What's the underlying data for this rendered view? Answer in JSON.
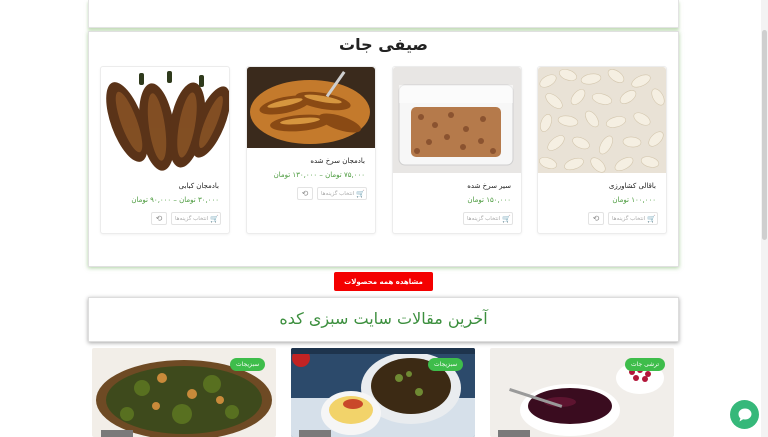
{
  "section": {
    "title": "صیفی جات"
  },
  "products": [
    {
      "name": "باقالی کشاورزی",
      "price": "۱۰۰,۰۰۰ تومان",
      "choose_label": "انتخاب گزینه‌ها"
    },
    {
      "name": "سیر سرخ شده",
      "price": "۱۵۰,۰۰۰ تومان",
      "choose_label": "انتخاب گزینه‌ها"
    },
    {
      "name": "بادمجان سرخ شده",
      "price": "۷۵,۰۰۰ تومان – ۱۳۰,۰۰۰ تومان",
      "choose_label": "انتخاب گزینه‌ها"
    },
    {
      "name": "بادمجان کبابی",
      "price": "۳۰,۰۰۰ تومان – ۹۰,۰۰۰ تومان",
      "choose_label": "انتخاب گزینه‌ها"
    }
  ],
  "all_products_button": "مشاهده همه محصولات",
  "articles": {
    "title": "آخرین مقالات سایت سبزی کده",
    "posts": [
      {
        "tag": "ترشی جات"
      },
      {
        "tag": "سبزیجات"
      },
      {
        "tag": "سبزیجات"
      }
    ]
  },
  "colors": {
    "accent_green": "#3c8f3e",
    "price_green": "#4a9a3c",
    "button_red": "#f40000",
    "tag_green": "#3ebd4b",
    "chat_green": "#36b87a"
  }
}
